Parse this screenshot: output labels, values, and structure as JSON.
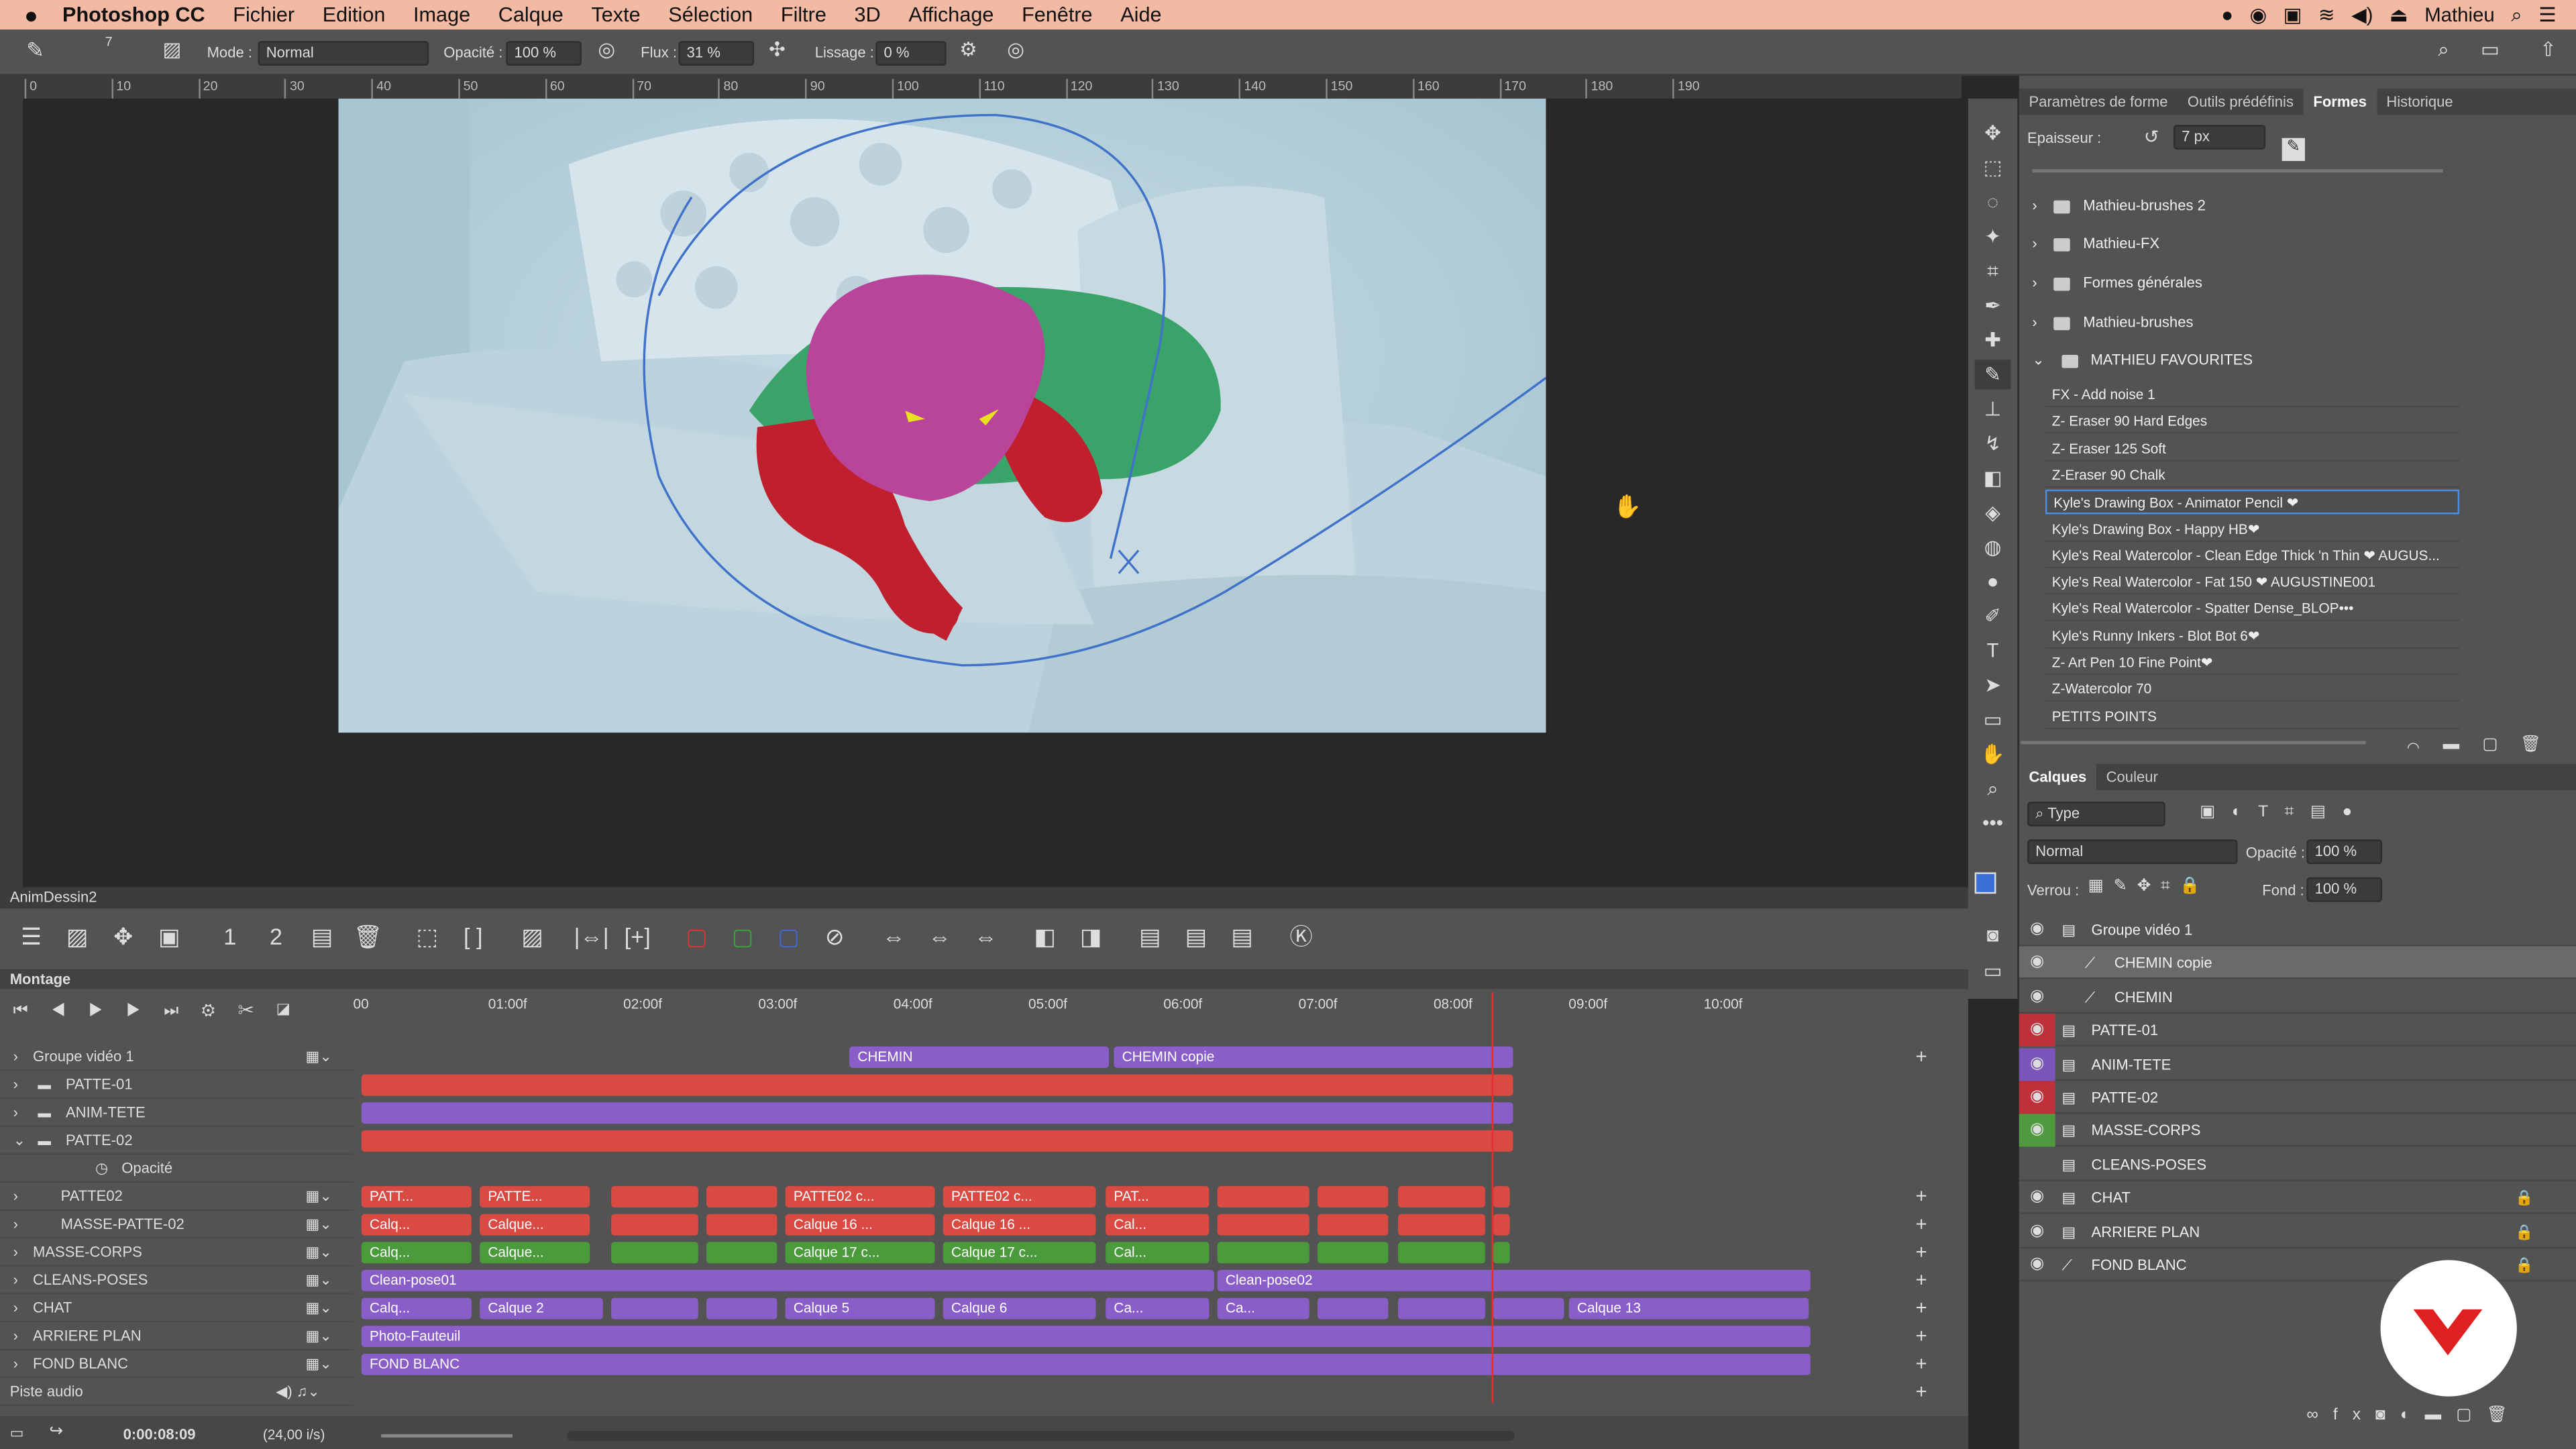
{
  "menubar": {
    "apple": "",
    "app": "Photoshop CC",
    "items": [
      "Fichier",
      "Edition",
      "Image",
      "Calque",
      "Texte",
      "Sélection",
      "Filtre",
      "3D",
      "Affichage",
      "Fenêtre",
      "Aide"
    ],
    "user": "Mathieu"
  },
  "options": {
    "mode_label": "Mode :",
    "mode_value": "Normal",
    "opacity_label": "Opacité :",
    "opacity_value": "100 %",
    "flux_label": "Flux :",
    "flux_value": "31 %",
    "lissage_label": "Lissage :",
    "lissage_value": "0 %",
    "brush_size": "7"
  },
  "ruler": {
    "ticks": [
      "0",
      "10",
      "20",
      "30",
      "40",
      "50",
      "60",
      "70",
      "80",
      "90",
      "100",
      "110",
      "120",
      "130",
      "140",
      "150",
      "160",
      "170",
      "180",
      "190"
    ]
  },
  "right_panel": {
    "brush_tabs": [
      "Paramètres de forme",
      "Outils prédéfinis",
      "Formes",
      "Historique"
    ],
    "epaisseur_label": "Epaisseur :",
    "epaisseur_value": "7 px",
    "folders": [
      "Mathieu-brushes 2",
      "Mathieu-FX",
      "Formes générales",
      "Mathieu-brushes",
      "MATHIEU FAVOURITES"
    ],
    "brushes": [
      "FX - Add noise 1",
      "Z- Eraser 90 Hard Edges",
      "Z- Eraser 125 Soft",
      "Z-Eraser 90 Chalk",
      "Kyle's Drawing Box - Animator Pencil ❤",
      "Kyle's Drawing Box - Happy HB❤",
      "Kyle's Real Watercolor - Clean Edge Thick 'n Thin ❤ AUGUS...",
      "Kyle's Real Watercolor - Fat 150 ❤ AUGUSTINE001",
      "Kyle's Real Watercolor - Spatter Dense_BLOP•••",
      "Kyle's Runny Inkers - Blot Bot 6❤",
      "Z- Art Pen 10 Fine Point❤",
      "Z-Watercolor 70",
      "PETITS POINTS"
    ],
    "layers_tabs": [
      "Calques",
      "Couleur"
    ],
    "filter_type": "Type",
    "blend_mode": "Normal",
    "opacity_label": "Opacité :",
    "opacity_value": "100 %",
    "lock_label": "Verrou :",
    "fill_label": "Fond :",
    "fill_value": "100 %",
    "layers": [
      "Groupe vidéo 1",
      "CHEMIN copie",
      "CHEMIN",
      "PATTE-01",
      "ANIM-TETE",
      "PATTE-02",
      "MASSE-CORPS",
      "CLEANS-POSES",
      "CHAT",
      "ARRIERE PLAN",
      "FOND BLANC"
    ]
  },
  "timeline": {
    "doc_title": "AnimDessin2",
    "panel_title": "Montage",
    "time_labels": [
      "00",
      "01:00f",
      "02:00f",
      "03:00f",
      "04:00f",
      "05:00f",
      "06:00f",
      "07:00f",
      "08:00f",
      "09:00f",
      "10:00f"
    ],
    "tracks": [
      "Groupe vidéo 1",
      "PATTE-01",
      "ANIM-TETE",
      "PATTE-02",
      "Opacité",
      "PATTE02",
      "MASSE-PATTE-02",
      "MASSE-CORPS",
      "CLEANS-POSES",
      "CHAT",
      "ARRIERE PLAN",
      "FOND BLANC",
      "Piste audio"
    ],
    "clips": {
      "chemin": "CHEMIN",
      "chemin_copie": "CHEMIN copie",
      "patte02": [
        "PATT...",
        "PATTE...",
        "PATTE02 c...",
        "PATTE02 c...",
        "PAT..."
      ],
      "masse_patte": [
        "Calq...",
        "Calque...",
        "Calque 16 ...",
        "Calque 16 ...",
        "Cal..."
      ],
      "masse_corps": [
        "Calq...",
        "Calque...",
        "Calque 17 c...",
        "Calque 17 c...",
        "Cal..."
      ],
      "clean1": "Clean-pose01",
      "clean2": "Clean-pose02",
      "chat": [
        "Calq...",
        "Calque 2",
        "Calque 5",
        "Calque 6",
        "Ca...",
        "Ca...",
        "Calque 13"
      ],
      "arriere": "Photo-Fauteuil",
      "fond": "FOND BLANC"
    },
    "timecode": "0:00:08:09",
    "fps": "(24,00 i/s)"
  },
  "colors": {
    "red": "#d94a43",
    "purple": "#8a5ec8",
    "green": "#4b9a3c",
    "accent": "#4a90e2",
    "menubar": "#f2b9a3"
  }
}
